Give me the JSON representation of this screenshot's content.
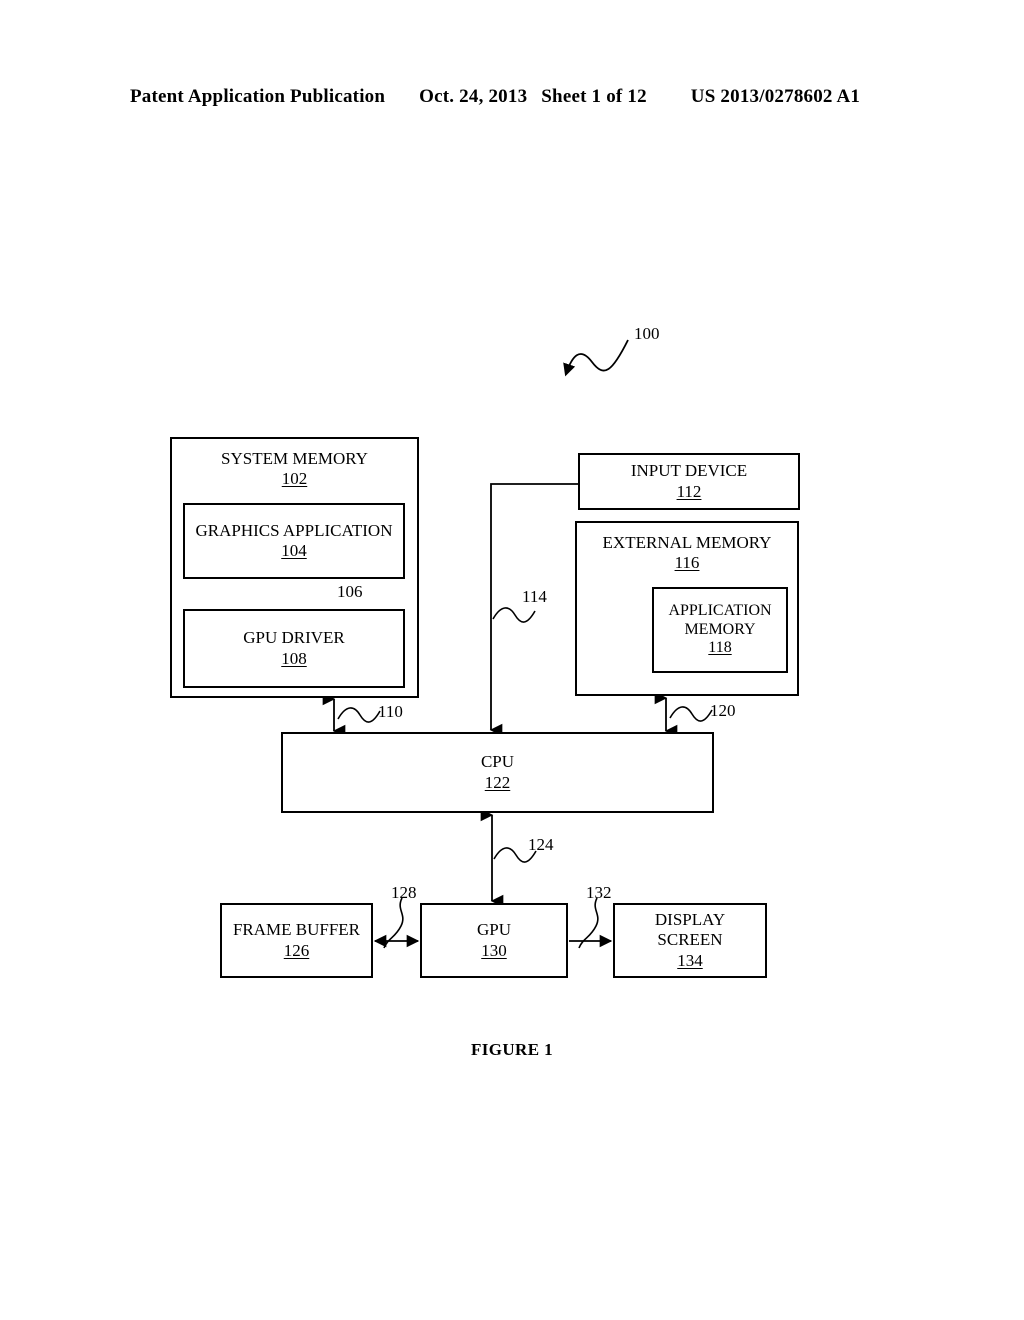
{
  "header": {
    "publication": "Patent Application Publication",
    "date": "Oct. 24, 2013",
    "sheet": "Sheet 1 of 12",
    "patent_number": "US 2013/0278602 A1"
  },
  "figure": {
    "caption": "FIGURE 1",
    "system_ref": "100"
  },
  "blocks": {
    "system_memory": {
      "title": "SYSTEM MEMORY",
      "ref": "102"
    },
    "graphics_application": {
      "title": "GRAPHICS APPLICATION",
      "ref": "104"
    },
    "gpu_driver": {
      "title": "GPU DRIVER",
      "ref": "108"
    },
    "input_device": {
      "title": "INPUT DEVICE",
      "ref": "112"
    },
    "external_memory": {
      "title": "EXTERNAL MEMORY",
      "ref": "116"
    },
    "application_memory": {
      "title_line1": "APPLICATION",
      "title_line2": "MEMORY",
      "ref": "118"
    },
    "cpu": {
      "title": "CPU",
      "ref": "122"
    },
    "frame_buffer": {
      "title": "FRAME BUFFER",
      "ref": "126"
    },
    "gpu": {
      "title": "GPU",
      "ref": "130"
    },
    "display_screen": {
      "title_line1": "DISPLAY",
      "title_line2": "SCREEN",
      "ref": "134"
    }
  },
  "connectors": {
    "app_to_driver": {
      "ref": "106"
    },
    "sysmem_to_cpu": {
      "ref": "110"
    },
    "input_to_cpu": {
      "ref": "114"
    },
    "extmem_to_cpu": {
      "ref": "120"
    },
    "cpu_to_gpu": {
      "ref": "124"
    },
    "framebuffer_to_gpu": {
      "ref": "128"
    },
    "gpu_to_display": {
      "ref": "132"
    }
  },
  "colors": {
    "ink": "#000000",
    "paper": "#ffffff"
  }
}
